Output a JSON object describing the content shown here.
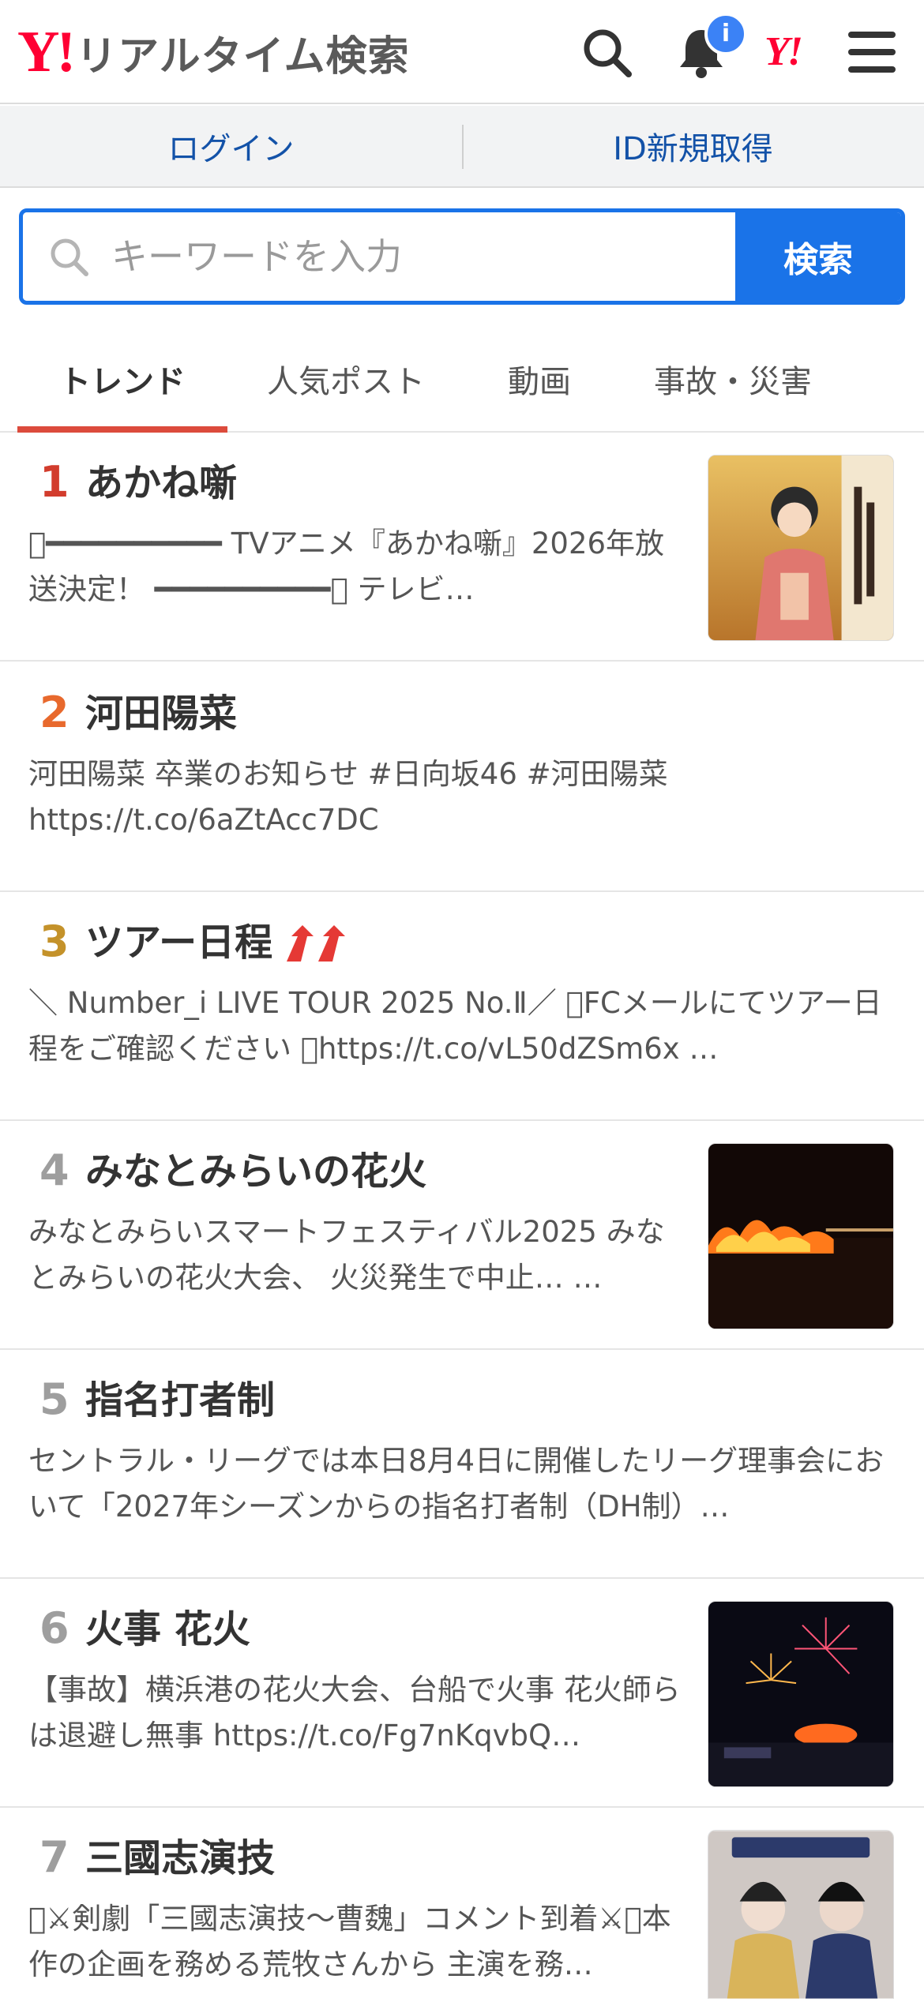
{
  "header": {
    "logo_mark": "Y!",
    "logo_text": "リアルタイム検索",
    "notification_badge": "i",
    "yahoo_mini": "Y!"
  },
  "login_bar": {
    "login": "ログイン",
    "register": "ID新規取得"
  },
  "search": {
    "placeholder": "キーワードを入力",
    "button": "検索"
  },
  "tabs": [
    {
      "label": "トレンド",
      "active": true
    },
    {
      "label": "人気ポスト",
      "active": false
    },
    {
      "label": "動画",
      "active": false
    },
    {
      "label": "事故・災害",
      "active": false
    }
  ],
  "colors": {
    "accent": "#1a73e8",
    "rank_1": "#d23c2d",
    "rank_2": "#e8692d",
    "rank_3": "#c4922a",
    "rank_other": "#9e9e9e",
    "trend_arrow": "#e53935"
  },
  "trends": [
    {
      "rank": "1",
      "title": "あかね噺",
      "body": "􀀀━━━━━━━━━━ TVアニメ『あかね噺』2026年放送決定！ ━━━━━━━━━━􀀀 テレビ…",
      "thumb": "anime-illustration",
      "arrows": false
    },
    {
      "rank": "2",
      "title": "河田陽菜",
      "body": "河田陽菜 卒業のお知らせ #日向坂46 #河田陽菜 https://t.co/6aZtAcc7DC",
      "thumb": null,
      "arrows": false
    },
    {
      "rank": "3",
      "title": "ツアー日程",
      "body": "＼ Number_i LIVE TOUR 2025 No.Ⅱ／ 􀀀FCメールにてツアー日程をご確認ください 􀀀https://t.co/vL50dZSm6x …",
      "thumb": null,
      "arrows": true
    },
    {
      "rank": "4",
      "title": "みなとみらいの花火",
      "body": "みなとみらいスマートフェスティバル2025 みなとみらいの花火大会、 火災発生で中止… …",
      "thumb": "fire-night-photo",
      "arrows": false
    },
    {
      "rank": "5",
      "title": "指名打者制",
      "body": "セントラル・リーグでは本日8月4日に開催したリーグ理事会において「2027年シーズンからの指名打者制（DH制）…",
      "thumb": null,
      "arrows": false
    },
    {
      "rank": "6",
      "title": "火事 花火",
      "body": "【事故】横浜港の花火大会、台船で火事 花火師らは退避し無事 https://t.co/Fg7nKqvbQ…",
      "thumb": "fireworks-photo",
      "arrows": false
    },
    {
      "rank": "7",
      "title": "三國志演技",
      "body": "􀀀⚔剣劇「三國志演技〜曹魏」コメント到着⚔􀀀本作の企画を務める荒牧さんから 主演を務…",
      "thumb": "stage-actors-photo",
      "arrows": false
    }
  ]
}
